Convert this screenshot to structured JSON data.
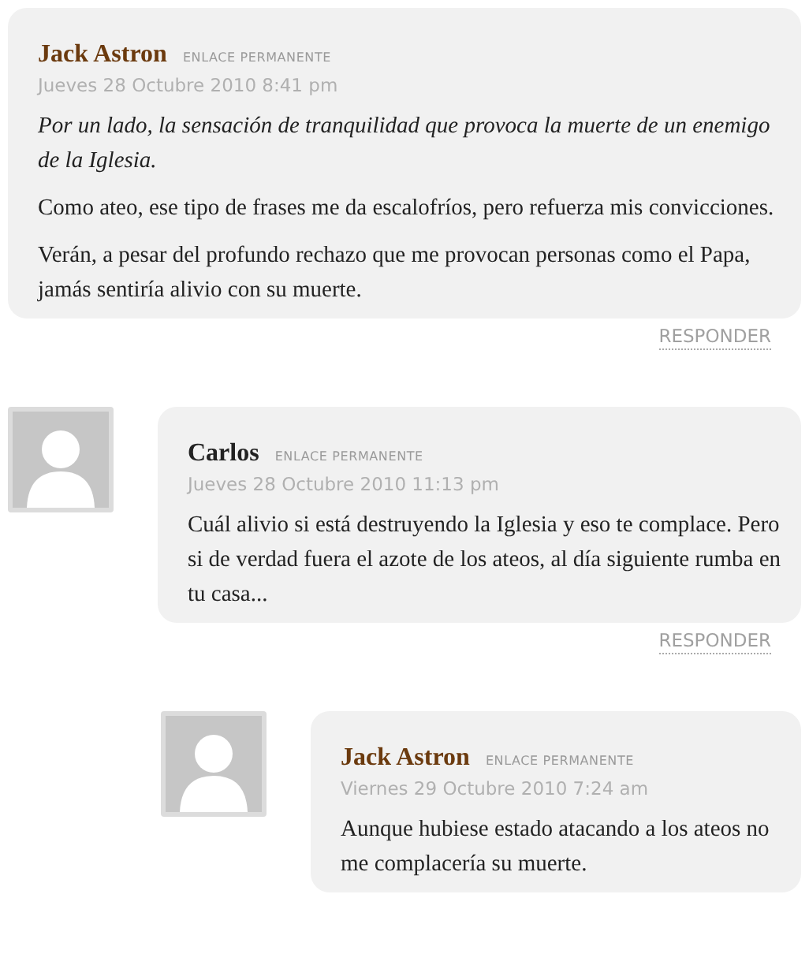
{
  "comments": [
    {
      "author": "Jack Astron",
      "color": "#6b3a0e",
      "permalink": "ENLACE PERMANENTE",
      "date": "Jueves 28 Octubre 2010 8:41 pm",
      "avatar": false,
      "paragraphs": [
        {
          "kind": "quote",
          "text": "Por un lado, la sensación de tranquilidad que provoca la muerte de un enemigo de la Iglesia."
        },
        {
          "kind": "text",
          "text": "Como ateo, ese tipo de frases me da escalofríos, pero refuerza mis convicciones."
        },
        {
          "kind": "text",
          "text": "Verán, a pesar del profundo rechazo que me provocan personas como el Papa, jamás sentiría alivio con su muerte."
        }
      ],
      "reply": "RESPONDER",
      "children": [
        {
          "author": "Carlos",
          "color": "#222222",
          "permalink": "ENLACE PERMANENTE",
          "date": "Jueves 28 Octubre 2010 11:13 pm",
          "avatar": true,
          "paragraphs": [
            {
              "kind": "text",
              "text": "Cuál alivio si está destruyendo la Iglesia y eso te complace. Pero si de verdad fuera el azote de los ateos, al día siguiente rumba en tu casa..."
            }
          ],
          "reply": "RESPONDER",
          "children": [
            {
              "author": "Jack Astron",
              "color": "#6b3a0e",
              "permalink": "ENLACE PERMANENTE",
              "date": "Viernes 29 Octubre 2010 7:24 am",
              "avatar": true,
              "paragraphs": [
                {
                  "kind": "text",
                  "text": "Aunque hubiese estado atacando a los ateos no me complacería su muerte."
                }
              ]
            }
          ]
        }
      ]
    }
  ]
}
